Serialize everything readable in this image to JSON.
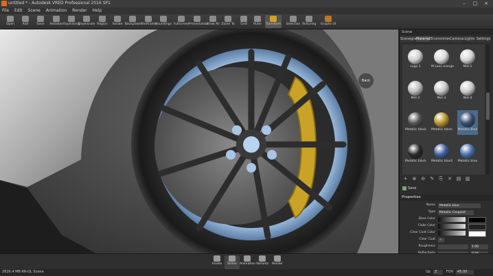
{
  "window": {
    "title": "untitled * - Autodesk VRED Professional 2016 SP1",
    "controls": [
      "–",
      "□",
      "×"
    ]
  },
  "menu": [
    "File",
    "Edit",
    "Scene",
    "Animation",
    "Render",
    "Help"
  ],
  "toolbar": [
    {
      "label": "Open",
      "icon": "folder-open-icon"
    },
    {
      "label": "Add",
      "icon": "add-file-icon"
    },
    {
      "label": "Save",
      "icon": "save-icon"
    },
    {
      "label": "Antialias",
      "icon": "antialias-icon"
    },
    {
      "label": "Raytracing",
      "icon": "raytracing-icon"
    },
    {
      "label": "Downscale",
      "icon": "downscale-icon"
    },
    {
      "label": "Region",
      "icon": "region-icon"
    },
    {
      "label": "Isolate",
      "icon": "isolate-icon"
    },
    {
      "label": "Backplate",
      "icon": "backplate-icon"
    },
    {
      "label": "Wireframe",
      "icon": "wireframe-icon"
    },
    {
      "label": "Boundings",
      "icon": "boundings-icon"
    },
    {
      "label": "Fullscreen",
      "icon": "fullscreen-icon"
    },
    {
      "label": "Presentation",
      "icon": "presentation-icon"
    },
    {
      "label": "Show All",
      "icon": "show-all-icon"
    },
    {
      "label": "Zoom To",
      "icon": "zoom-to-icon"
    },
    {
      "label": "Grid",
      "icon": "grid-icon"
    },
    {
      "label": "Ruler",
      "icon": "ruler-icon"
    },
    {
      "label": "Transform",
      "icon": "transform-icon"
    },
    {
      "label": "Selection",
      "icon": "selection-icon"
    },
    {
      "label": "Texturing",
      "icon": "texturing-icon"
    },
    {
      "label": "Graphs UI",
      "icon": "graphs-ui-icon"
    }
  ],
  "viewport": {
    "back_label": "Back"
  },
  "panel": {
    "title": "Scene",
    "tabs": [
      "Scenegraph",
      "Materials",
      "Environments",
      "Cameras",
      "Lights",
      "Settings"
    ],
    "active_tab": "Materials",
    "materials": [
      {
        "name": "Logo 1",
        "color": "#cfcfcf"
      },
      {
        "name": "M Lens orange",
        "color": "#d8d8d8"
      },
      {
        "name": "Met-1",
        "color": "#d4d4d4"
      },
      {
        "name": "Met-2",
        "color": "#bdbdbd"
      },
      {
        "name": "Met-3",
        "color": "#c8c8c8"
      },
      {
        "name": "Met-4",
        "color": "#cccccc"
      },
      {
        "name": "Metallic black",
        "color": "#555555"
      },
      {
        "name": "Metallic black",
        "color": "#b8952a"
      },
      {
        "name": "Metallic blue",
        "color": "#3a4f72"
      },
      {
        "name": "Metallic black",
        "color": "#2a2a2a"
      },
      {
        "name": "Metallic blue2",
        "color": "#3e5f9c"
      },
      {
        "name": "Metallic blue",
        "color": "#4a6fa8"
      }
    ],
    "selected_material": 8,
    "material_toolbar": [
      "+",
      "⊕",
      "⊖",
      "✎",
      "⎘",
      "✕",
      "▤",
      "▥"
    ],
    "save_label": "Save",
    "properties_title": "Properties",
    "properties": [
      {
        "key": "Name",
        "value": "Metallic blue",
        "type": "text"
      },
      {
        "key": "Type",
        "value": "Metallic Carpaint",
        "type": "select"
      },
      {
        "key": "Base Color",
        "value": "",
        "type": "color",
        "color": "#000000"
      },
      {
        "key": "Flake Color",
        "value": "",
        "type": "color",
        "color": "#222222"
      },
      {
        "key": "Clear Coat Color",
        "value": "",
        "type": "color",
        "color": "#ffffff"
      },
      {
        "key": "Clear Coat",
        "value": "✓",
        "type": "check"
      },
      {
        "key": "Roughness",
        "value": "1.00",
        "type": "slider"
      },
      {
        "key": "Reflectivity",
        "value": "0.04",
        "type": "slider"
      },
      {
        "key": "Flake Size",
        "value": "0.03",
        "type": "slider"
      }
    ]
  },
  "bottom_tabs": [
    {
      "label": "Assets",
      "icon": "assets-icon"
    },
    {
      "label": "Scene",
      "icon": "scene-icon"
    },
    {
      "label": "Animation",
      "icon": "animation-icon"
    },
    {
      "label": "Variants",
      "icon": "variants-icon"
    },
    {
      "label": "Render",
      "icon": "render-icon"
    }
  ],
  "active_bottom_tab": "Scene",
  "status": {
    "left": "2626.4 MB  RR-GL  Scene",
    "up_label": "Up",
    "up_value": "Z",
    "fov_label": "FOV",
    "fov_value": "45.00"
  }
}
